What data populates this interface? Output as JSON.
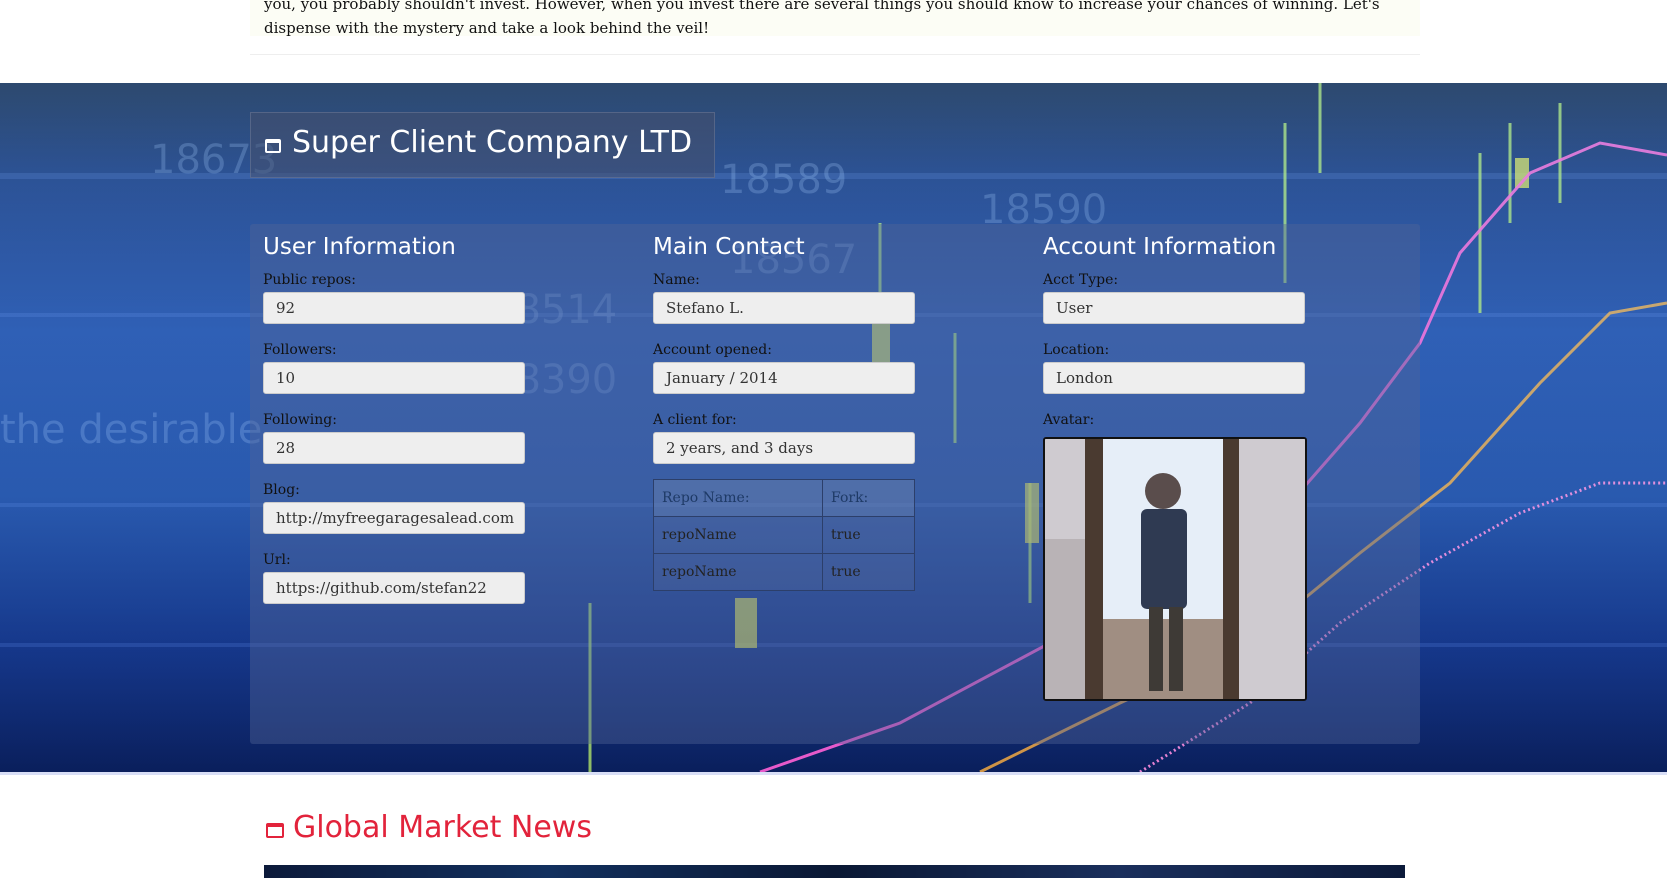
{
  "intro": {
    "text": "you, you probably shouldn't invest. However, when you invest there are several things you should know to increase your chances of winning. Let's dispense with the mystery and take a look behind the veil!"
  },
  "company": {
    "title": "Super Client Company LTD",
    "icon": "window-icon"
  },
  "user_info": {
    "heading": "User Information",
    "public_repos_label": "Public repos:",
    "public_repos": "92",
    "followers_label": "Followers:",
    "followers": "10",
    "following_label": "Following:",
    "following": "28",
    "blog_label": "Blog:",
    "blog": "http://myfreegaragesalead.com",
    "url_label": "Url:",
    "url": "https://github.com/stefan22"
  },
  "main_contact": {
    "heading": "Main Contact",
    "name_label": "Name:",
    "name": "Stefano L.",
    "opened_label": "Account opened:",
    "opened": "January / 2014",
    "client_for_label": "A client for:",
    "client_for": "2 years, and 3 days",
    "repo_table": {
      "headers": [
        "Repo Name:",
        "Fork:"
      ],
      "rows": [
        [
          "repoName",
          "true"
        ],
        [
          "repoName",
          "true"
        ]
      ]
    }
  },
  "account_info": {
    "heading": "Account Information",
    "type_label": "Acct Type:",
    "type": "User",
    "location_label": "Location:",
    "location": "London",
    "avatar_label": "Avatar:"
  },
  "news": {
    "title": "Global Market News",
    "icon": "window-icon",
    "accent": "#e2233b"
  }
}
